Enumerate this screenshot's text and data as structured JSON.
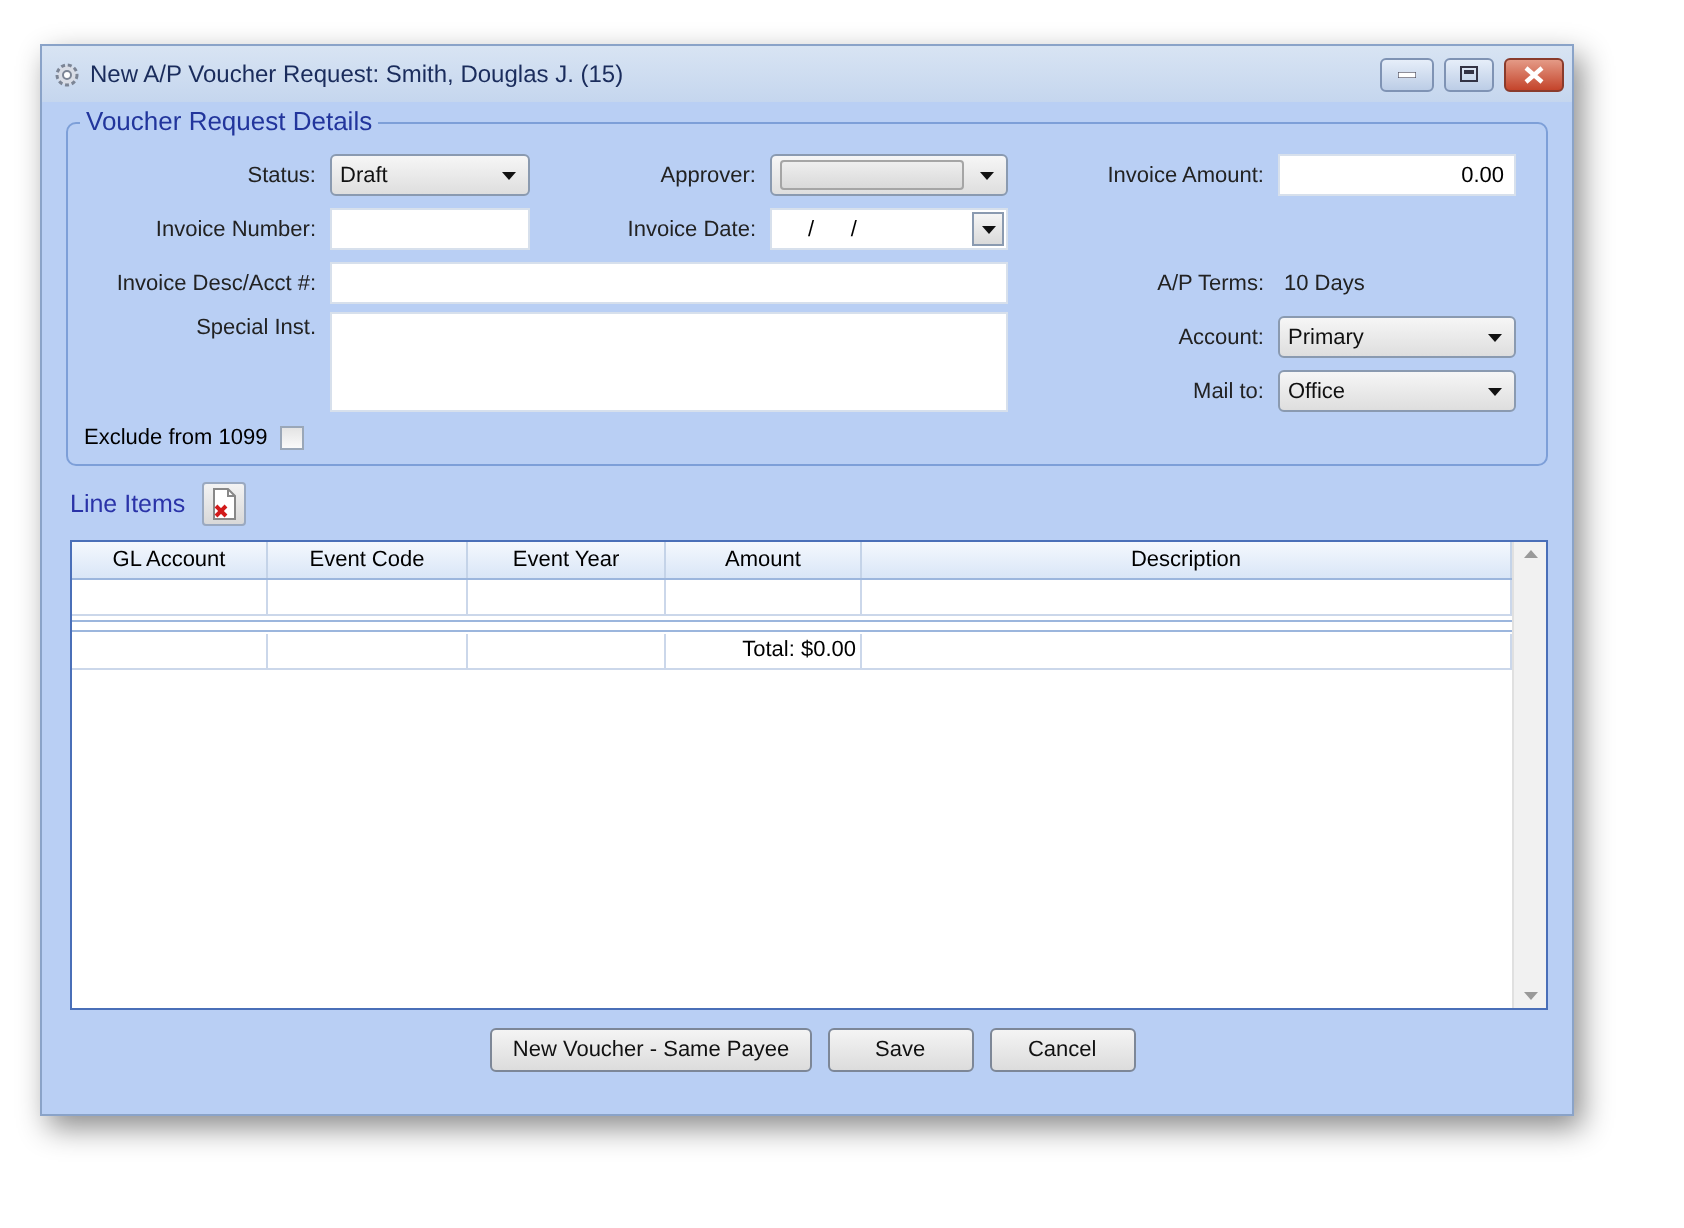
{
  "window": {
    "title": "New A/P Voucher Request: Smith, Douglas J. (15)"
  },
  "details": {
    "title": "Voucher Request Details",
    "status": {
      "label": "Status:",
      "value": "Draft"
    },
    "approver": {
      "label": "Approver:"
    },
    "invoice_amount": {
      "label": "Invoice Amount:",
      "value": "0.00"
    },
    "invoice_number": {
      "label": "Invoice Number:"
    },
    "invoice_date": {
      "label": "Invoice Date:",
      "value": "/      /"
    },
    "invoice_desc": {
      "label": "Invoice Desc/Acct #:"
    },
    "ap_terms": {
      "label": "A/P Terms:",
      "value": "10 Days"
    },
    "special_inst": {
      "label": "Special Inst."
    },
    "account": {
      "label": "Account:",
      "value": "Primary"
    },
    "mail_to": {
      "label": "Mail to:",
      "value": "Office"
    },
    "exclude_1099": {
      "label": "Exclude from 1099",
      "checked": false
    }
  },
  "line_items": {
    "title": "Line Items",
    "columns": [
      "GL Account",
      "Event Code",
      "Event Year",
      "Amount",
      "Description"
    ],
    "total": "Total: $0.00"
  },
  "buttons": [
    {
      "label": "New Voucher - Same Payee"
    },
    {
      "label": "Save"
    },
    {
      "label": "Cancel"
    }
  ]
}
